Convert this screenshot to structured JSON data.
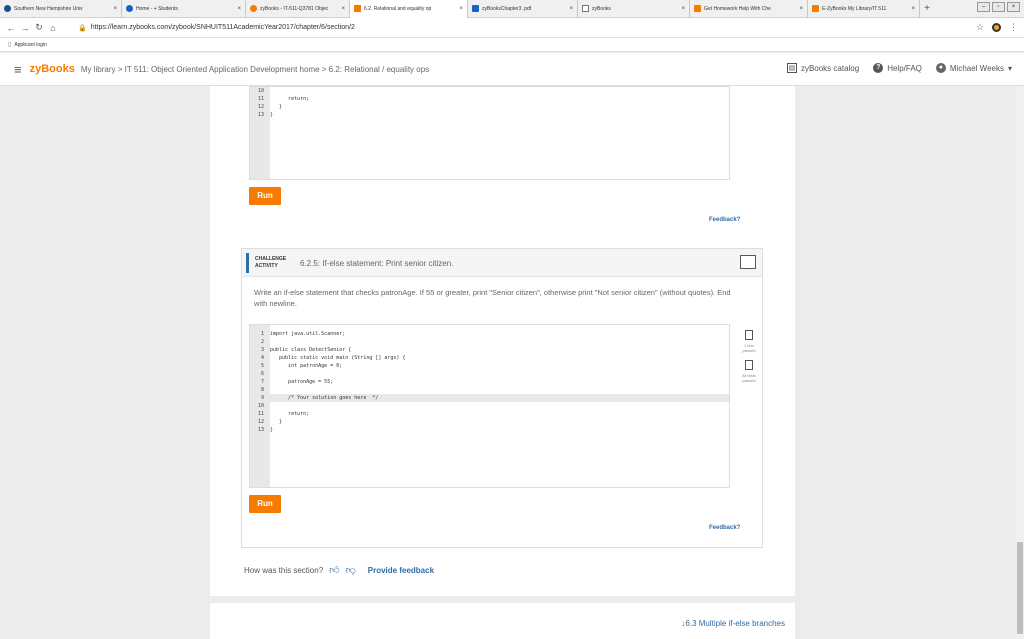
{
  "browser": {
    "tabs": [
      {
        "label": "Southern New Hampshire Univ",
        "color": "#1a4e8a"
      },
      {
        "label": "Home - + Students",
        "color": "#1565c0"
      },
      {
        "label": "zyBooks - IT-511-Q3781 Objec",
        "color": "#f57c00"
      },
      {
        "label": "6.2. Relational and equality op",
        "color": "#f57c00"
      },
      {
        "label": "zyBooksChapter3 .pdf",
        "color": "#1565c0"
      },
      {
        "label": "zyBooks",
        "color": "#777777"
      },
      {
        "label": "Get Homework Help With Che",
        "color": "#f57c00"
      },
      {
        "label": "E-ZyBooks My Library/IT 511",
        "color": "#f57c00"
      }
    ],
    "url": "https://learn.zybooks.com/zybook/SNHUIT511AcademicYear2017/chapter/6/section/2",
    "bookmark": "Applicant login"
  },
  "header": {
    "logo": "zyBooks",
    "breadcrumb": "My library > IT 511: Object Oriented Application Development home > 6.2: Relational / equality ops",
    "catalog": "zyBooks catalog",
    "help": "Help/FAQ",
    "user": "Michael Weeks"
  },
  "editor1": {
    "lines": [
      {
        "n": "10",
        "t": ""
      },
      {
        "n": "11",
        "t": "      return;"
      },
      {
        "n": "12",
        "t": "   }"
      },
      {
        "n": "13",
        "t": "}"
      }
    ]
  },
  "run_label": "Run",
  "feedback_label": "Feedback?",
  "challenge": {
    "tag_line1": "CHALLENGE",
    "tag_line2": "ACTIVITY",
    "title": "6.2.5: If-else statement: Print senior citizen.",
    "text": "Write an if-else statement that checks patronAge. If 55 or greater, print \"Senior citizen\", otherwise print \"Not senior citizen\" (without quotes). End with newline.",
    "lines": [
      {
        "n": "1",
        "t": "import java.util.Scanner;"
      },
      {
        "n": "2",
        "t": ""
      },
      {
        "n": "3",
        "t": "public class DetectSenior {"
      },
      {
        "n": "4",
        "t": "   public static void main (String [] args) {"
      },
      {
        "n": "5",
        "t": "      int patronAge = 0;"
      },
      {
        "n": "6",
        "t": ""
      },
      {
        "n": "7",
        "t": "      patronAge = 55;"
      },
      {
        "n": "8",
        "t": ""
      },
      {
        "n": "9",
        "t": "      /* Your solution goes here  */"
      },
      {
        "n": "10",
        "t": ""
      },
      {
        "n": "11",
        "t": "      return;"
      },
      {
        "n": "12",
        "t": "   }"
      },
      {
        "n": "13",
        "t": "}"
      }
    ],
    "test1": "1 test passed",
    "test2": "All tests passed"
  },
  "rating": {
    "prompt": "How was this section?",
    "provide": "Provide feedback"
  },
  "next_section": "6.3 Multiple if-else branches"
}
